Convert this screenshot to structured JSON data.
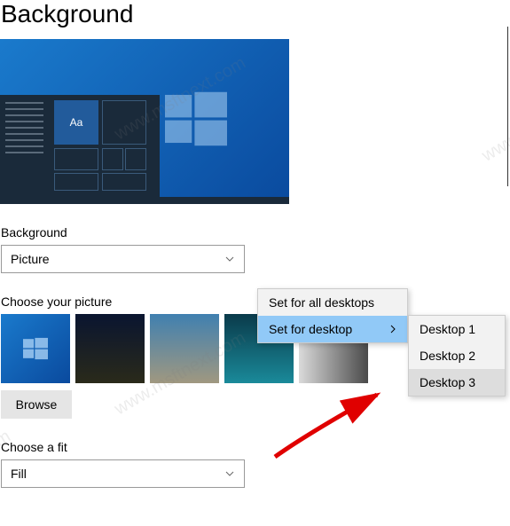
{
  "title": "Background",
  "preview": {
    "sample_text": "Aa"
  },
  "background_section": {
    "label": "Background",
    "value": "Picture"
  },
  "choose_picture": {
    "label": "Choose your picture",
    "thumbnails": [
      "windows-default",
      "night-sky",
      "beach",
      "underwater",
      "waterfall"
    ],
    "browse_label": "Browse"
  },
  "choose_fit": {
    "label": "Choose a fit",
    "value": "Fill"
  },
  "context_menu_primary": {
    "items": [
      {
        "label": "Set for all desktops",
        "hover": false,
        "has_submenu": false
      },
      {
        "label": "Set for desktop",
        "hover": true,
        "has_submenu": true
      }
    ]
  },
  "context_menu_secondary": {
    "items": [
      {
        "label": "Desktop 1",
        "selected": false
      },
      {
        "label": "Desktop 2",
        "selected": false
      },
      {
        "label": "Desktop 3",
        "selected": true
      }
    ]
  },
  "watermark_text": "www.msftnext.com"
}
